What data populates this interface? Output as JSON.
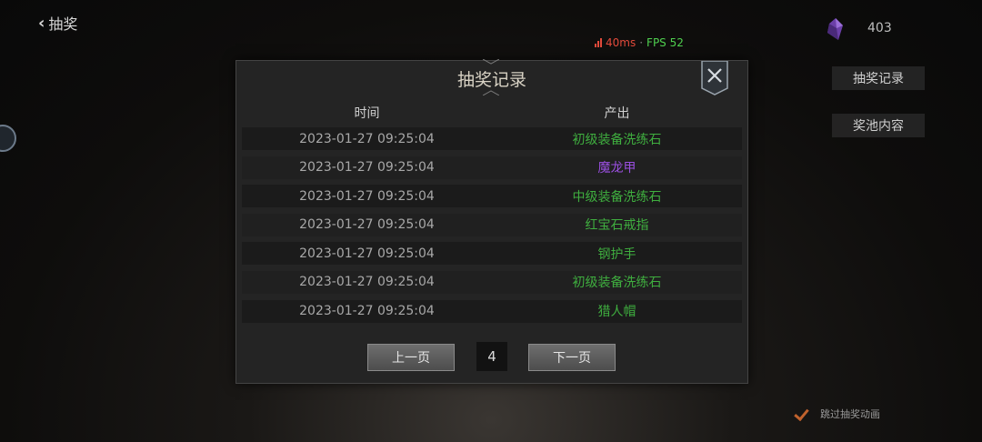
{
  "topbar": {
    "back_label": "抽奖",
    "latency": "40ms",
    "separator": "·",
    "fps": "FPS 52",
    "gem_count": "403"
  },
  "side": {
    "record_button": "抽奖记录",
    "pool_button": "奖池内容",
    "skip_animation": "跳过抽奖动画"
  },
  "modal": {
    "title": "抽奖记录",
    "columns": {
      "time": "时间",
      "output": "产出"
    },
    "rows": [
      {
        "time": "2023-01-27 09:25:04",
        "item": "初级装备洗练石",
        "color": "#3fae3f"
      },
      {
        "time": "2023-01-27 09:25:04",
        "item": "魔龙甲",
        "color": "#9a4fe0"
      },
      {
        "time": "2023-01-27 09:25:04",
        "item": "中级装备洗练石",
        "color": "#3fae3f"
      },
      {
        "time": "2023-01-27 09:25:04",
        "item": "红宝石戒指",
        "color": "#3fae3f"
      },
      {
        "time": "2023-01-27 09:25:04",
        "item": "钢护手",
        "color": "#3fae3f"
      },
      {
        "time": "2023-01-27 09:25:04",
        "item": "初级装备洗练石",
        "color": "#3fae3f"
      },
      {
        "time": "2023-01-27 09:25:04",
        "item": "猎人帽",
        "color": "#3fae3f"
      }
    ],
    "pager": {
      "prev": "上一页",
      "page": "4",
      "next": "下一页"
    }
  }
}
